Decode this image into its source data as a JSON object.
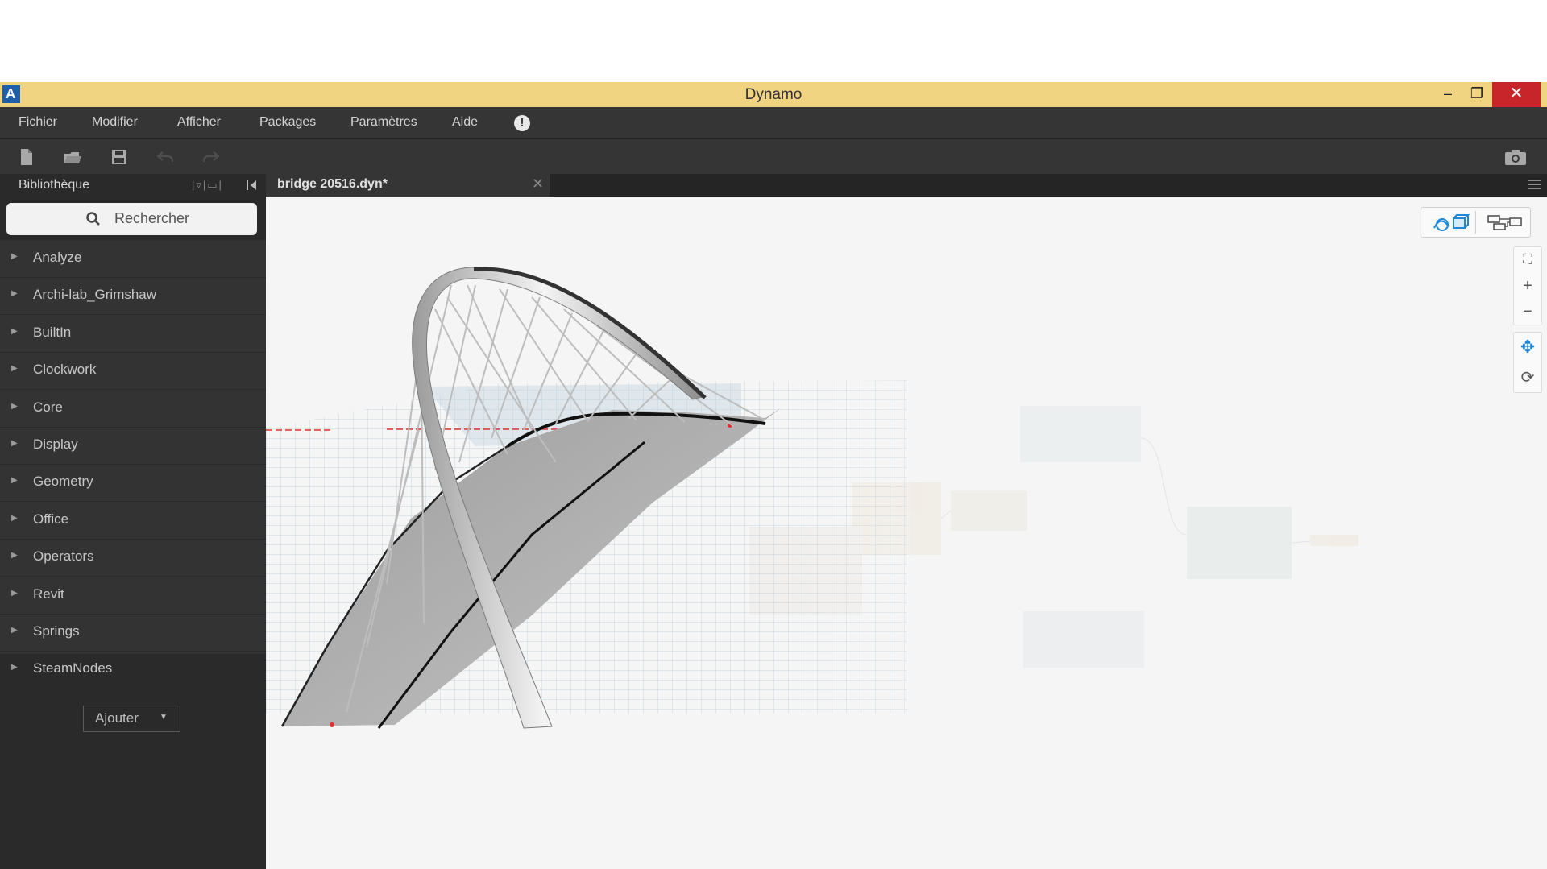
{
  "window": {
    "title": "Dynamo",
    "logo_letter": "A",
    "controls": {
      "minimize": "–",
      "maximize": "❐",
      "close": "✕"
    }
  },
  "menu": {
    "items": [
      "Fichier",
      "Modifier",
      "Afficher",
      "Packages",
      "Paramètres",
      "Aide"
    ],
    "info_glyph": "!"
  },
  "toolbar": {
    "icons": [
      "new-file-icon",
      "open-file-icon",
      "save-icon",
      "undo-icon",
      "redo-icon",
      "screenshot-camera-icon"
    ]
  },
  "library": {
    "title": "Bibliothèque",
    "search_placeholder": "Rechercher",
    "categories": [
      "Analyze",
      "Archi-lab_Grimshaw",
      "BuiltIn",
      "Clockwork",
      "Core",
      "Display",
      "Geometry",
      "Office",
      "Operators",
      "Revit",
      "Springs",
      "SteamNodes"
    ],
    "add_button": "Ajouter"
  },
  "tab": {
    "label": "bridge 20516.dyn*",
    "close_glyph": "✕"
  },
  "viewport": {
    "toggle_icons": [
      "geometry-view-icon",
      "graph-view-icon"
    ],
    "nav": {
      "zoom_fit": "⛶",
      "zoom_in": "+",
      "zoom_out": "−",
      "pan": "✥",
      "orbit": "⟳"
    }
  },
  "colors": {
    "titlebar": "#f0d482",
    "close_button": "#c8252b",
    "menubar": "#353535",
    "library_list": "#333333",
    "workspace": "#f5f5f5",
    "accent_blue": "#1e88d6"
  }
}
